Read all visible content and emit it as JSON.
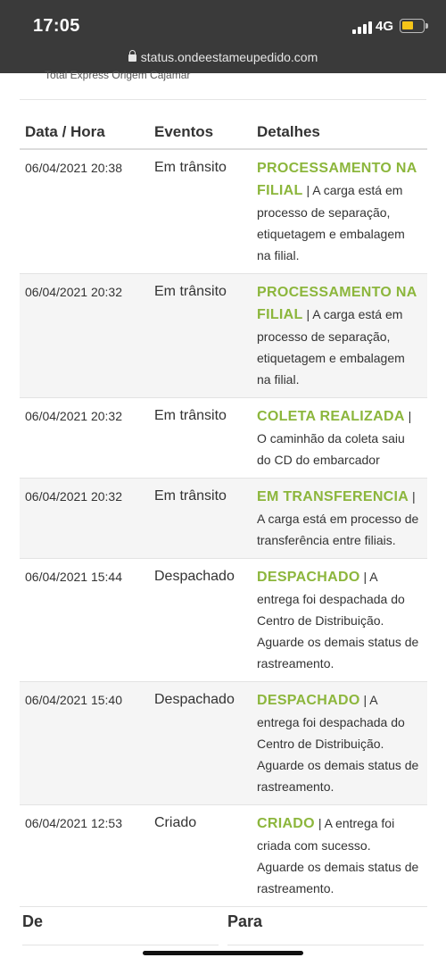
{
  "status_bar": {
    "time": "17:05",
    "network": "4G"
  },
  "browser": {
    "url": "status.ondeestameupedido.com"
  },
  "origin_text": "Total Express Origem Cajamar",
  "table": {
    "headers": [
      "Data / Hora",
      "Eventos",
      "Detalhes"
    ],
    "rows": [
      {
        "date": "06/04/2021 20:38",
        "event": "Em trânsito",
        "status": "PROCESSAMENTO NA FILIAL",
        "separator": "|",
        "detail": "A carga está em processo de separação, etiquetagem e embalagem na filial."
      },
      {
        "date": "06/04/2021 20:32",
        "event": "Em trânsito",
        "status": "PROCESSAMENTO NA FILIAL",
        "separator": "|",
        "detail": "A carga está em processo de separação, etiquetagem e embalagem na filial."
      },
      {
        "date": "06/04/2021 20:32",
        "event": "Em trânsito",
        "status": "COLETA REALIZADA",
        "separator": "|",
        "detail": "O caminhão da coleta saiu do CD do embarcador"
      },
      {
        "date": "06/04/2021 20:32",
        "event": "Em trânsito",
        "status": "EM TRANSFERENCIA",
        "separator": "|",
        "detail": "A carga está em processo de transferência entre filiais."
      },
      {
        "date": "06/04/2021 15:44",
        "event": "Despachado",
        "status": "DESPACHADO",
        "separator": "|",
        "detail": "A entrega foi despachada do Centro de Distribuição. Aguarde os demais status de rastreamento."
      },
      {
        "date": "06/04/2021 15:40",
        "event": "Despachado",
        "status": "DESPACHADO",
        "separator": "|",
        "detail": "A entrega foi despachada do Centro de Distribuição. Aguarde os demais status de rastreamento."
      },
      {
        "date": "06/04/2021 12:53",
        "event": "Criado",
        "status": "CRIADO",
        "separator": "|",
        "detail": "A entrega foi criada com sucesso. Aguarde os demais status de rastreamento."
      }
    ]
  },
  "footer": {
    "from_label": "De",
    "to_label": "Para"
  },
  "colors": {
    "status_green": "#8cb63c",
    "chrome_bg": "#3a3a3a",
    "battery": "#f5c518"
  }
}
